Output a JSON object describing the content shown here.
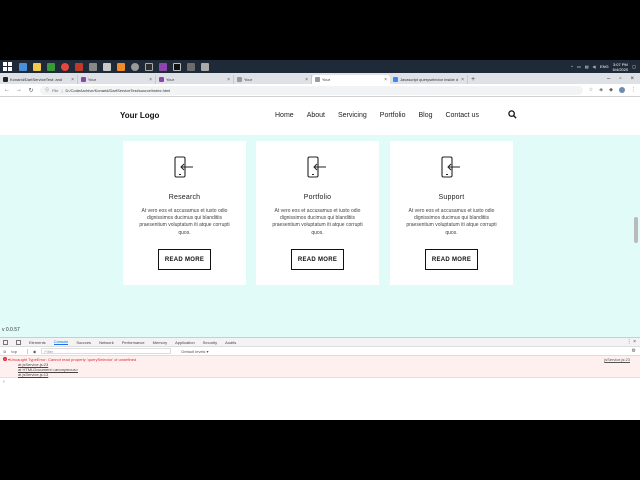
{
  "taskbar": {
    "time": "3:07 PM",
    "date": "6/4/2020",
    "lang": "ENG"
  },
  "browser": {
    "tabs": [
      {
        "label": "Konarid/DartServiceTest: and"
      },
      {
        "label": "Your"
      },
      {
        "label": "Your"
      },
      {
        "label": "Your"
      },
      {
        "label": "Your"
      },
      {
        "label": "Javascript queryselector inside d"
      }
    ],
    "address": {
      "scheme_label": "File",
      "path": "D:/CodeArchive/Konarid/DartServiceTest/source/index.html"
    }
  },
  "site": {
    "logo": "Your Logo",
    "nav": [
      "Home",
      "About",
      "Servicing",
      "Portfolio",
      "Blog",
      "Contact us"
    ],
    "cards": [
      {
        "title": "Research",
        "body": "At vero eos et accusamus et iusto odio dignissimos ducimus qui blanditiis praesentium voluptatum iti atque corrupti quos.",
        "button": "READ MORE"
      },
      {
        "title": "Portfolio",
        "body": "At vero eos et accusamus et iusto odio dignissimos ducimus qui blanditiis praesentium voluptatum iti atque corrupti quos.",
        "button": "READ MORE"
      },
      {
        "title": "Support",
        "body": "At vero eos et accusamus et iusto odio dignissimos ducimus qui blanditiis praesentium voluptatum iti atque corrupti quos.",
        "button": "READ MORE"
      }
    ],
    "version": "v 0.0.57"
  },
  "devtools": {
    "tabs": [
      "Elements",
      "Console",
      "Sources",
      "Network",
      "Performance",
      "Memory",
      "Application",
      "Security",
      "Audits"
    ],
    "context": "top",
    "filter_placeholder": "Filter",
    "levels": "Default levels ▾",
    "error": {
      "line1": "Uncaught TypeError: Cannot read property 'querySelector' of undefined",
      "line2": "at jsService.js:23",
      "line3": "at HTMLDocument.<anonymous>",
      "line4": "at jsService.js:13",
      "source": "jsService.js:23"
    }
  },
  "colors": {
    "page_bg": "#e0fbf8",
    "error_red": "#e0252e",
    "devtools_accent": "#1a73e8"
  }
}
